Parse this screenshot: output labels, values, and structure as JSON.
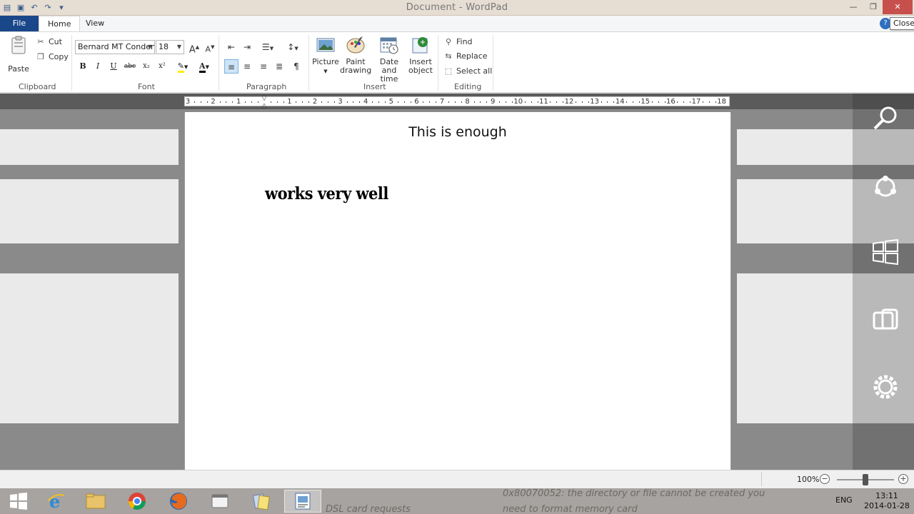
{
  "window": {
    "title": "Document - WordPad",
    "close_tooltip": "Close"
  },
  "tabs": {
    "file": "File",
    "home": "Home",
    "view": "View"
  },
  "ribbon": {
    "clipboard": {
      "label": "Clipboard",
      "paste": "Paste",
      "cut": "Cut",
      "copy": "Copy"
    },
    "font": {
      "label": "Font",
      "family": "Bernard MT Conden",
      "size": "18"
    },
    "paragraph": {
      "label": "Paragraph"
    },
    "insert": {
      "label": "Insert",
      "picture": "Picture",
      "paint_line1": "Paint",
      "paint_line2": "drawing",
      "date_line1": "Date and",
      "date_line2": "time",
      "object_line1": "Insert",
      "object_line2": "object"
    },
    "editing": {
      "label": "Editing",
      "find": "Find",
      "replace": "Replace",
      "select_all": "Select all"
    }
  },
  "ruler": {
    "labels": [
      "3",
      "2",
      "1",
      "",
      "1",
      "2",
      "3",
      "4",
      "5",
      "6",
      "7",
      "8",
      "9",
      "10",
      "11",
      "12",
      "13",
      "14",
      "15",
      "16",
      "17",
      "18"
    ]
  },
  "document": {
    "line1": "This is enough",
    "line2": "works very well"
  },
  "statusbar": {
    "zoom": "100%",
    "zoom_level": 0.5
  },
  "taskbar": {
    "background_text_1": "DSL card requests",
    "background_text_2": "0x80070052: the directory or file cannot be created you",
    "background_text_3": "need to format memory card",
    "lang": "ENG",
    "time": "13:11",
    "date": "2014-01-28"
  },
  "colors": {
    "file_tab": "#19478a",
    "close_button": "#c7504c"
  }
}
